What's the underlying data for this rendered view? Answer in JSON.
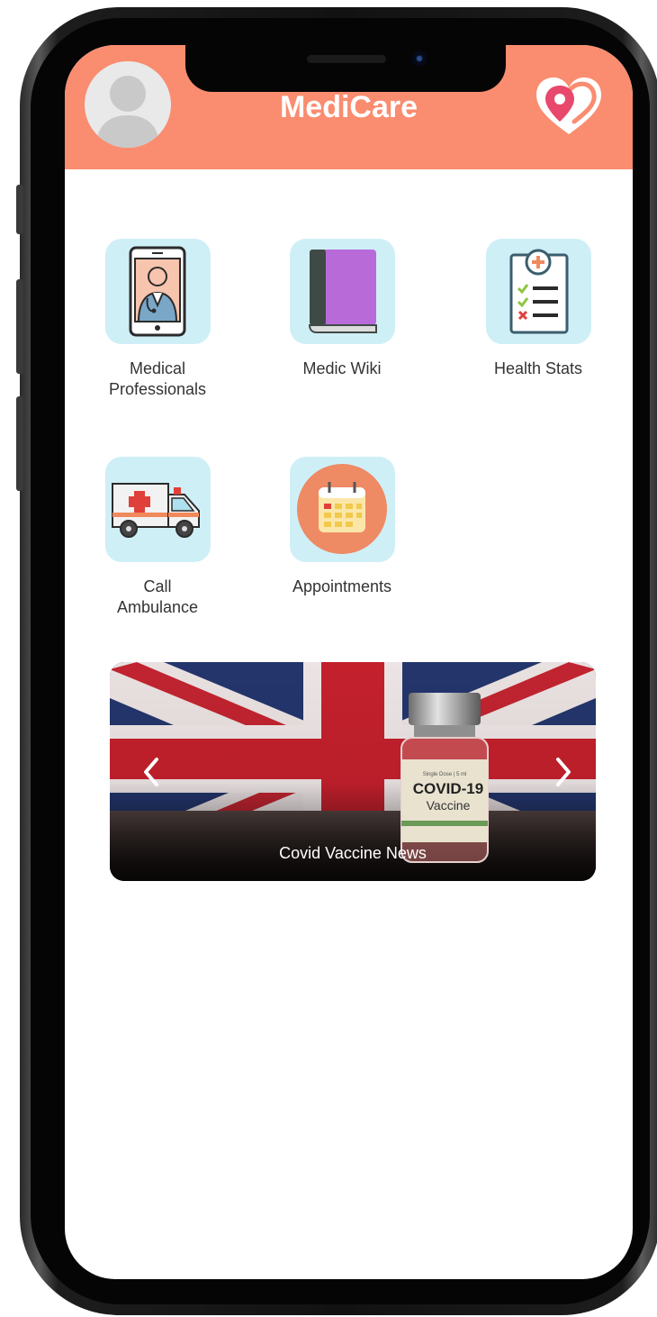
{
  "header": {
    "title": "MediCare",
    "background_color": "#FA8C70"
  },
  "menu": {
    "items": [
      {
        "label_line1": "Medical",
        "label_line2": "Professionals",
        "icon": "doctor-phone-icon"
      },
      {
        "label_line1": "Medic Wiki",
        "label_line2": "",
        "icon": "book-icon"
      },
      {
        "label_line1": "Health Stats",
        "label_line2": "",
        "icon": "clipboard-checklist-icon"
      },
      {
        "label_line1": "Call",
        "label_line2": "Ambulance",
        "icon": "ambulance-icon"
      },
      {
        "label_line1": "Appointments",
        "label_line2": "",
        "icon": "calendar-icon"
      }
    ],
    "tile_color": "#CFEFF7"
  },
  "carousel": {
    "caption": "Covid Vaccine News",
    "vial_label_line1": "COVID-19",
    "vial_label_line2": "Vaccine"
  }
}
